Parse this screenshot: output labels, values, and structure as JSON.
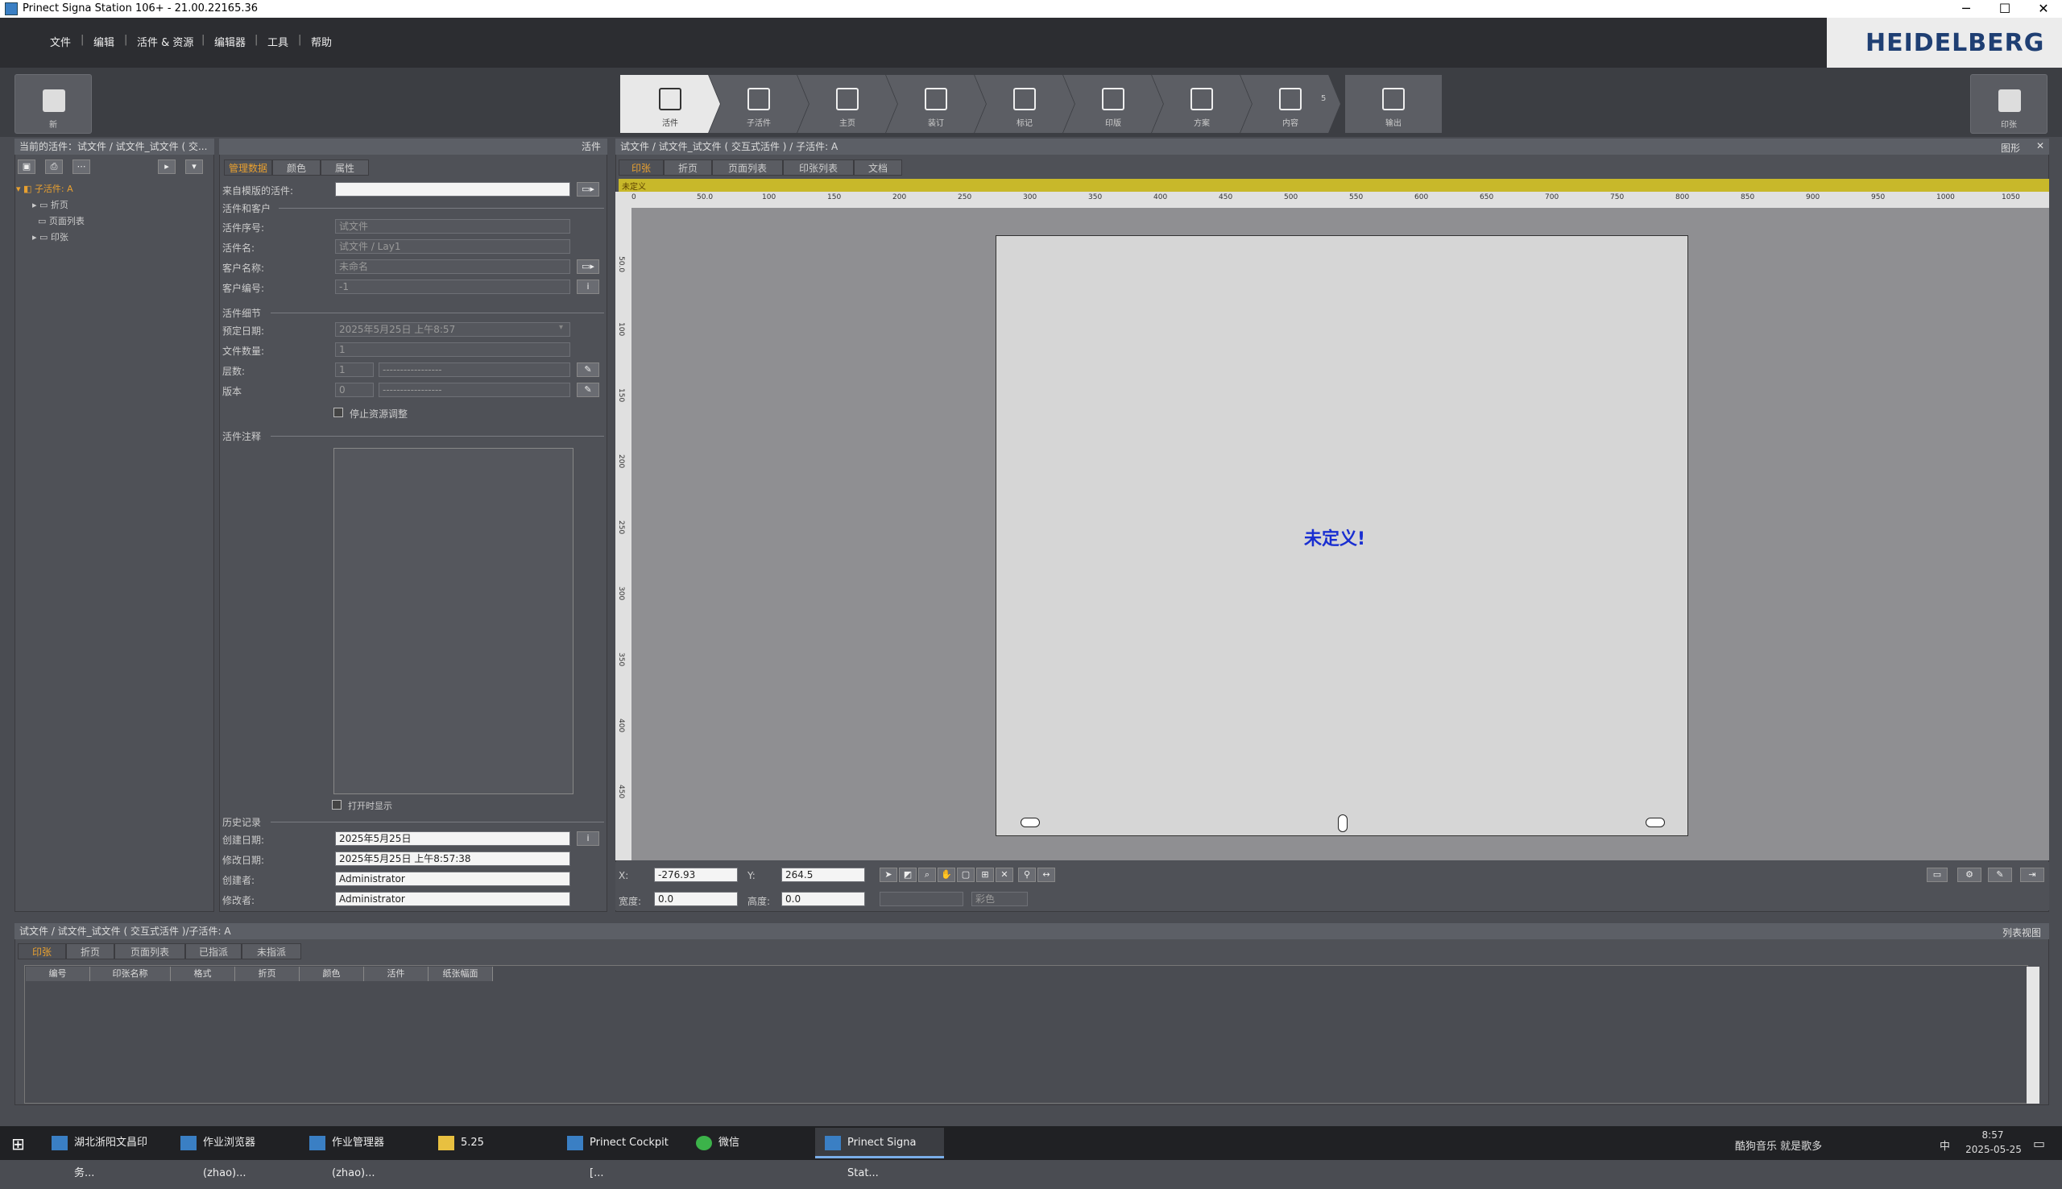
{
  "window": {
    "title": "Prinect Signa Station 106+ - 21.00.22165.36",
    "controls": [
      "─",
      "☐",
      "✕"
    ]
  },
  "menu": [
    "文件",
    "编辑",
    "活件 & 资源",
    "编辑器",
    "工具",
    "帮助"
  ],
  "brand": "HEIDELBERG",
  "toolbar": {
    "new_label": "新",
    "print_label": "印张"
  },
  "workflow": [
    {
      "label": "活件",
      "active": true
    },
    {
      "label": "子活件"
    },
    {
      "label": "主页"
    },
    {
      "label": "装订"
    },
    {
      "label": "标记"
    },
    {
      "label": "印版"
    },
    {
      "label": "方案"
    },
    {
      "label": "内容",
      "badge": "5"
    },
    {
      "label": "输出"
    }
  ],
  "left_panel": {
    "header": "当前的活件：试文件 / 试文件_试文件 ( 交...",
    "tree_root": "子活件: A",
    "tree_children": [
      "折页",
      "页面列表",
      "印张"
    ]
  },
  "job_panel": {
    "header": "活件",
    "tabs": [
      "管理数据",
      "颜色",
      "属性"
    ],
    "from_template_label": "来自模版的活件:",
    "section_job_customer": "活件和客户",
    "job_no_label": "活件序号:",
    "job_no": "试文件",
    "job_name_label": "活件名:",
    "job_name": "试文件 / Lay1",
    "customer_name_label": "客户名称:",
    "customer_name": "未命名",
    "customer_no_label": "客户编号:",
    "customer_no": "-1",
    "section_details": "活件细节",
    "due_label": "预定日期:",
    "due": "2025年5月25日 上午8:57",
    "file_count_label": "文件数量:",
    "file_count": "1",
    "layers_label": "层数:",
    "layers": "1",
    "layers_sel": "-----------------",
    "version_label": "版本",
    "version": "0",
    "version_sel": "-----------------",
    "stop_resource": "停止资源调整",
    "section_notes": "活件注释",
    "show_on_open": "打开时显示",
    "section_history": "历史记录",
    "created_label": "创建日期:",
    "created": "2025年5月25日",
    "modified_label": "修改日期:",
    "modified": "2025年5月25日  上午8:57:38",
    "creator_label": "创建者:",
    "creator": "Administrator",
    "modifier_label": "修改者:",
    "modifier": "Administrator"
  },
  "graphic_panel": {
    "header": "试文件 / 试文件_试文件 ( 交互式活件 ) / 子活件: A",
    "view_label": "图形",
    "tabs": [
      "印张",
      "折页",
      "页面列表",
      "印张列表",
      "文档"
    ],
    "strip_label": "未定义",
    "undefined_text": "未定义!",
    "x_label": "X:",
    "x": "-276.93",
    "y_label": "Y:",
    "y": "264.5",
    "w_label": "宽度:",
    "w": "0.0",
    "h_label": "高度:",
    "h": "0.0",
    "color_sel": "彩色",
    "ruler_h": [
      "0",
      "50.0",
      "100",
      "150",
      "200",
      "250",
      "300",
      "350",
      "400",
      "450",
      "500",
      "550",
      "600",
      "650",
      "700",
      "750",
      "800",
      "850",
      "900",
      "950",
      "1000",
      "1050"
    ],
    "ruler_v": [
      "50.0",
      "100",
      "150",
      "200",
      "250",
      "300",
      "350",
      "400",
      "450"
    ]
  },
  "bottom_panel": {
    "header": "试文件 / 试文件_试文件 ( 交互式活件 )/子活件: A",
    "view_label": "列表视图",
    "tabs": [
      "印张",
      "折页",
      "页面列表",
      "已指派",
      "未指派"
    ],
    "columns": [
      "编号",
      "印张名称",
      "格式",
      "折页",
      "颜色",
      "活件",
      "纸张幅面"
    ]
  },
  "taskbar": {
    "items": [
      "湖北浙阳文昌印务...",
      "作业浏览器 (zhao)...",
      "作业管理器 (zhao)...",
      "5.25",
      "Prinect Cockpit [...",
      "微信",
      "Prinect Signa Stat..."
    ],
    "tray_text": "酷狗音乐 就是歌多",
    "ime": "中",
    "time": "8:57",
    "date": "2025-05-25"
  }
}
